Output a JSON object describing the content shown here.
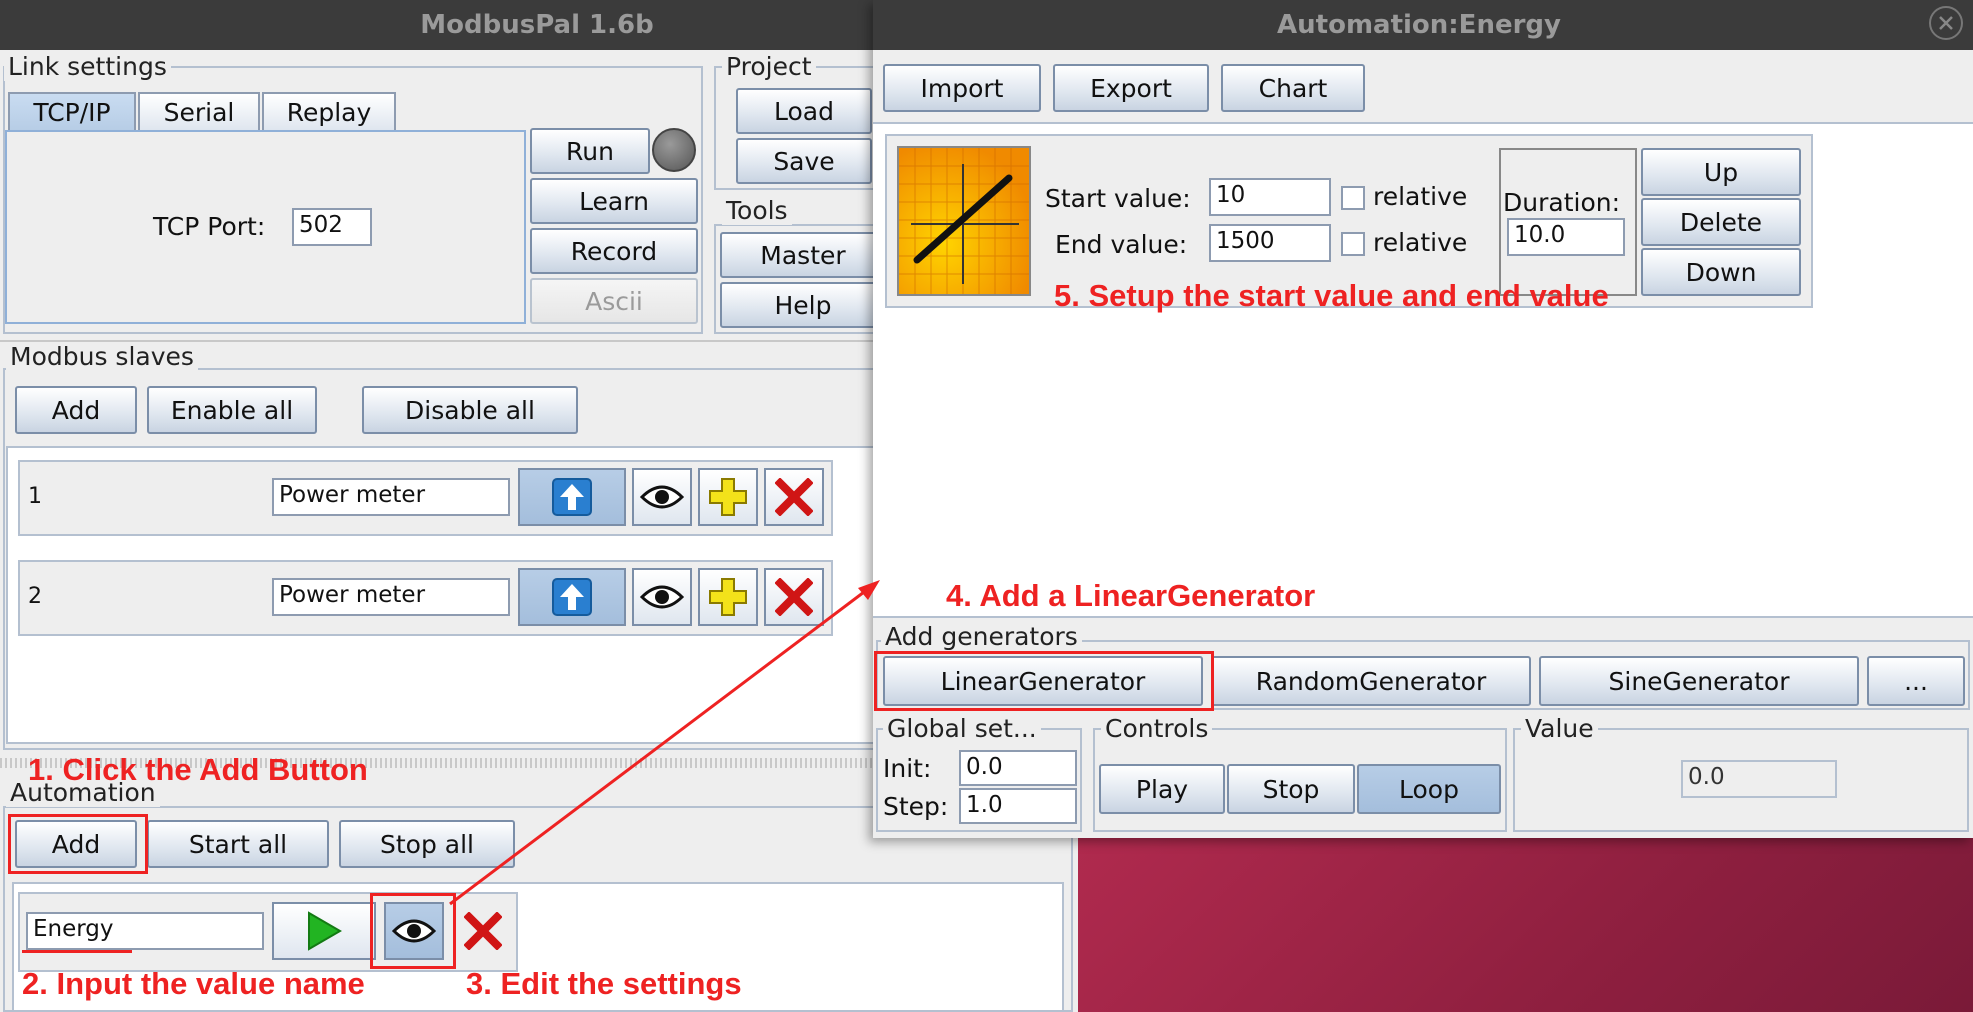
{
  "main_window": {
    "title": "ModbusPal 1.6b",
    "link_settings": {
      "title": "Link settings",
      "tabs": [
        "TCP/IP",
        "Serial",
        "Replay"
      ],
      "tcp_port_label": "TCP Port:",
      "tcp_port_value": "502",
      "run": "Run",
      "learn": "Learn",
      "record": "Record",
      "ascii": "Ascii"
    },
    "project": {
      "title": "Project",
      "load": "Load",
      "save": "Save"
    },
    "tools": {
      "title": "Tools",
      "master": "Master",
      "help": "Help"
    },
    "modbus_slaves": {
      "title": "Modbus slaves",
      "add": "Add",
      "enable_all": "Enable all",
      "disable_all": "Disable all",
      "rows": [
        {
          "id": "1",
          "name": "Power meter"
        },
        {
          "id": "2",
          "name": "Power meter"
        }
      ]
    },
    "automation": {
      "title": "Automation",
      "add": "Add",
      "start_all": "Start all",
      "stop_all": "Stop all",
      "item_name": "Energy"
    }
  },
  "automation_window": {
    "title": "Automation:Energy",
    "toolbar": {
      "import": "Import",
      "export": "Export",
      "chart": "Chart"
    },
    "generator": {
      "start_label": "Start value:",
      "start_value": "10",
      "end_label": "End value:",
      "end_value": "1500",
      "relative": "relative",
      "duration_label": "Duration:",
      "duration_value": "10.0",
      "up": "Up",
      "delete": "Delete",
      "down": "Down"
    },
    "add_generators": {
      "title": "Add generators",
      "items": [
        "LinearGenerator",
        "RandomGenerator",
        "SineGenerator",
        "..."
      ]
    },
    "global_settings": {
      "title": "Global set...",
      "init_label": "Init:",
      "init_value": "0.0",
      "step_label": "Step:",
      "step_value": "1.0"
    },
    "controls": {
      "title": "Controls",
      "play": "Play",
      "stop": "Stop",
      "loop": "Loop"
    },
    "value": {
      "title": "Value",
      "value": "0.0"
    }
  },
  "annotations": {
    "a1": "1. Click the Add Button",
    "a2": "2. Input the value name",
    "a3": "3. Edit the settings",
    "a4": "4. Add a LinearGenerator",
    "a5": "5. Setup the start value and end value"
  },
  "colors": {
    "annotation": "#ee2222",
    "titlebar": "#3b3b3b",
    "window": "#eeeeee",
    "desktop": "#a8274a"
  },
  "icons": [
    "upload-arrow-icon",
    "eye-icon",
    "add-plus-icon",
    "delete-x-icon",
    "play-icon",
    "close-icon",
    "linear-generator-icon"
  ]
}
